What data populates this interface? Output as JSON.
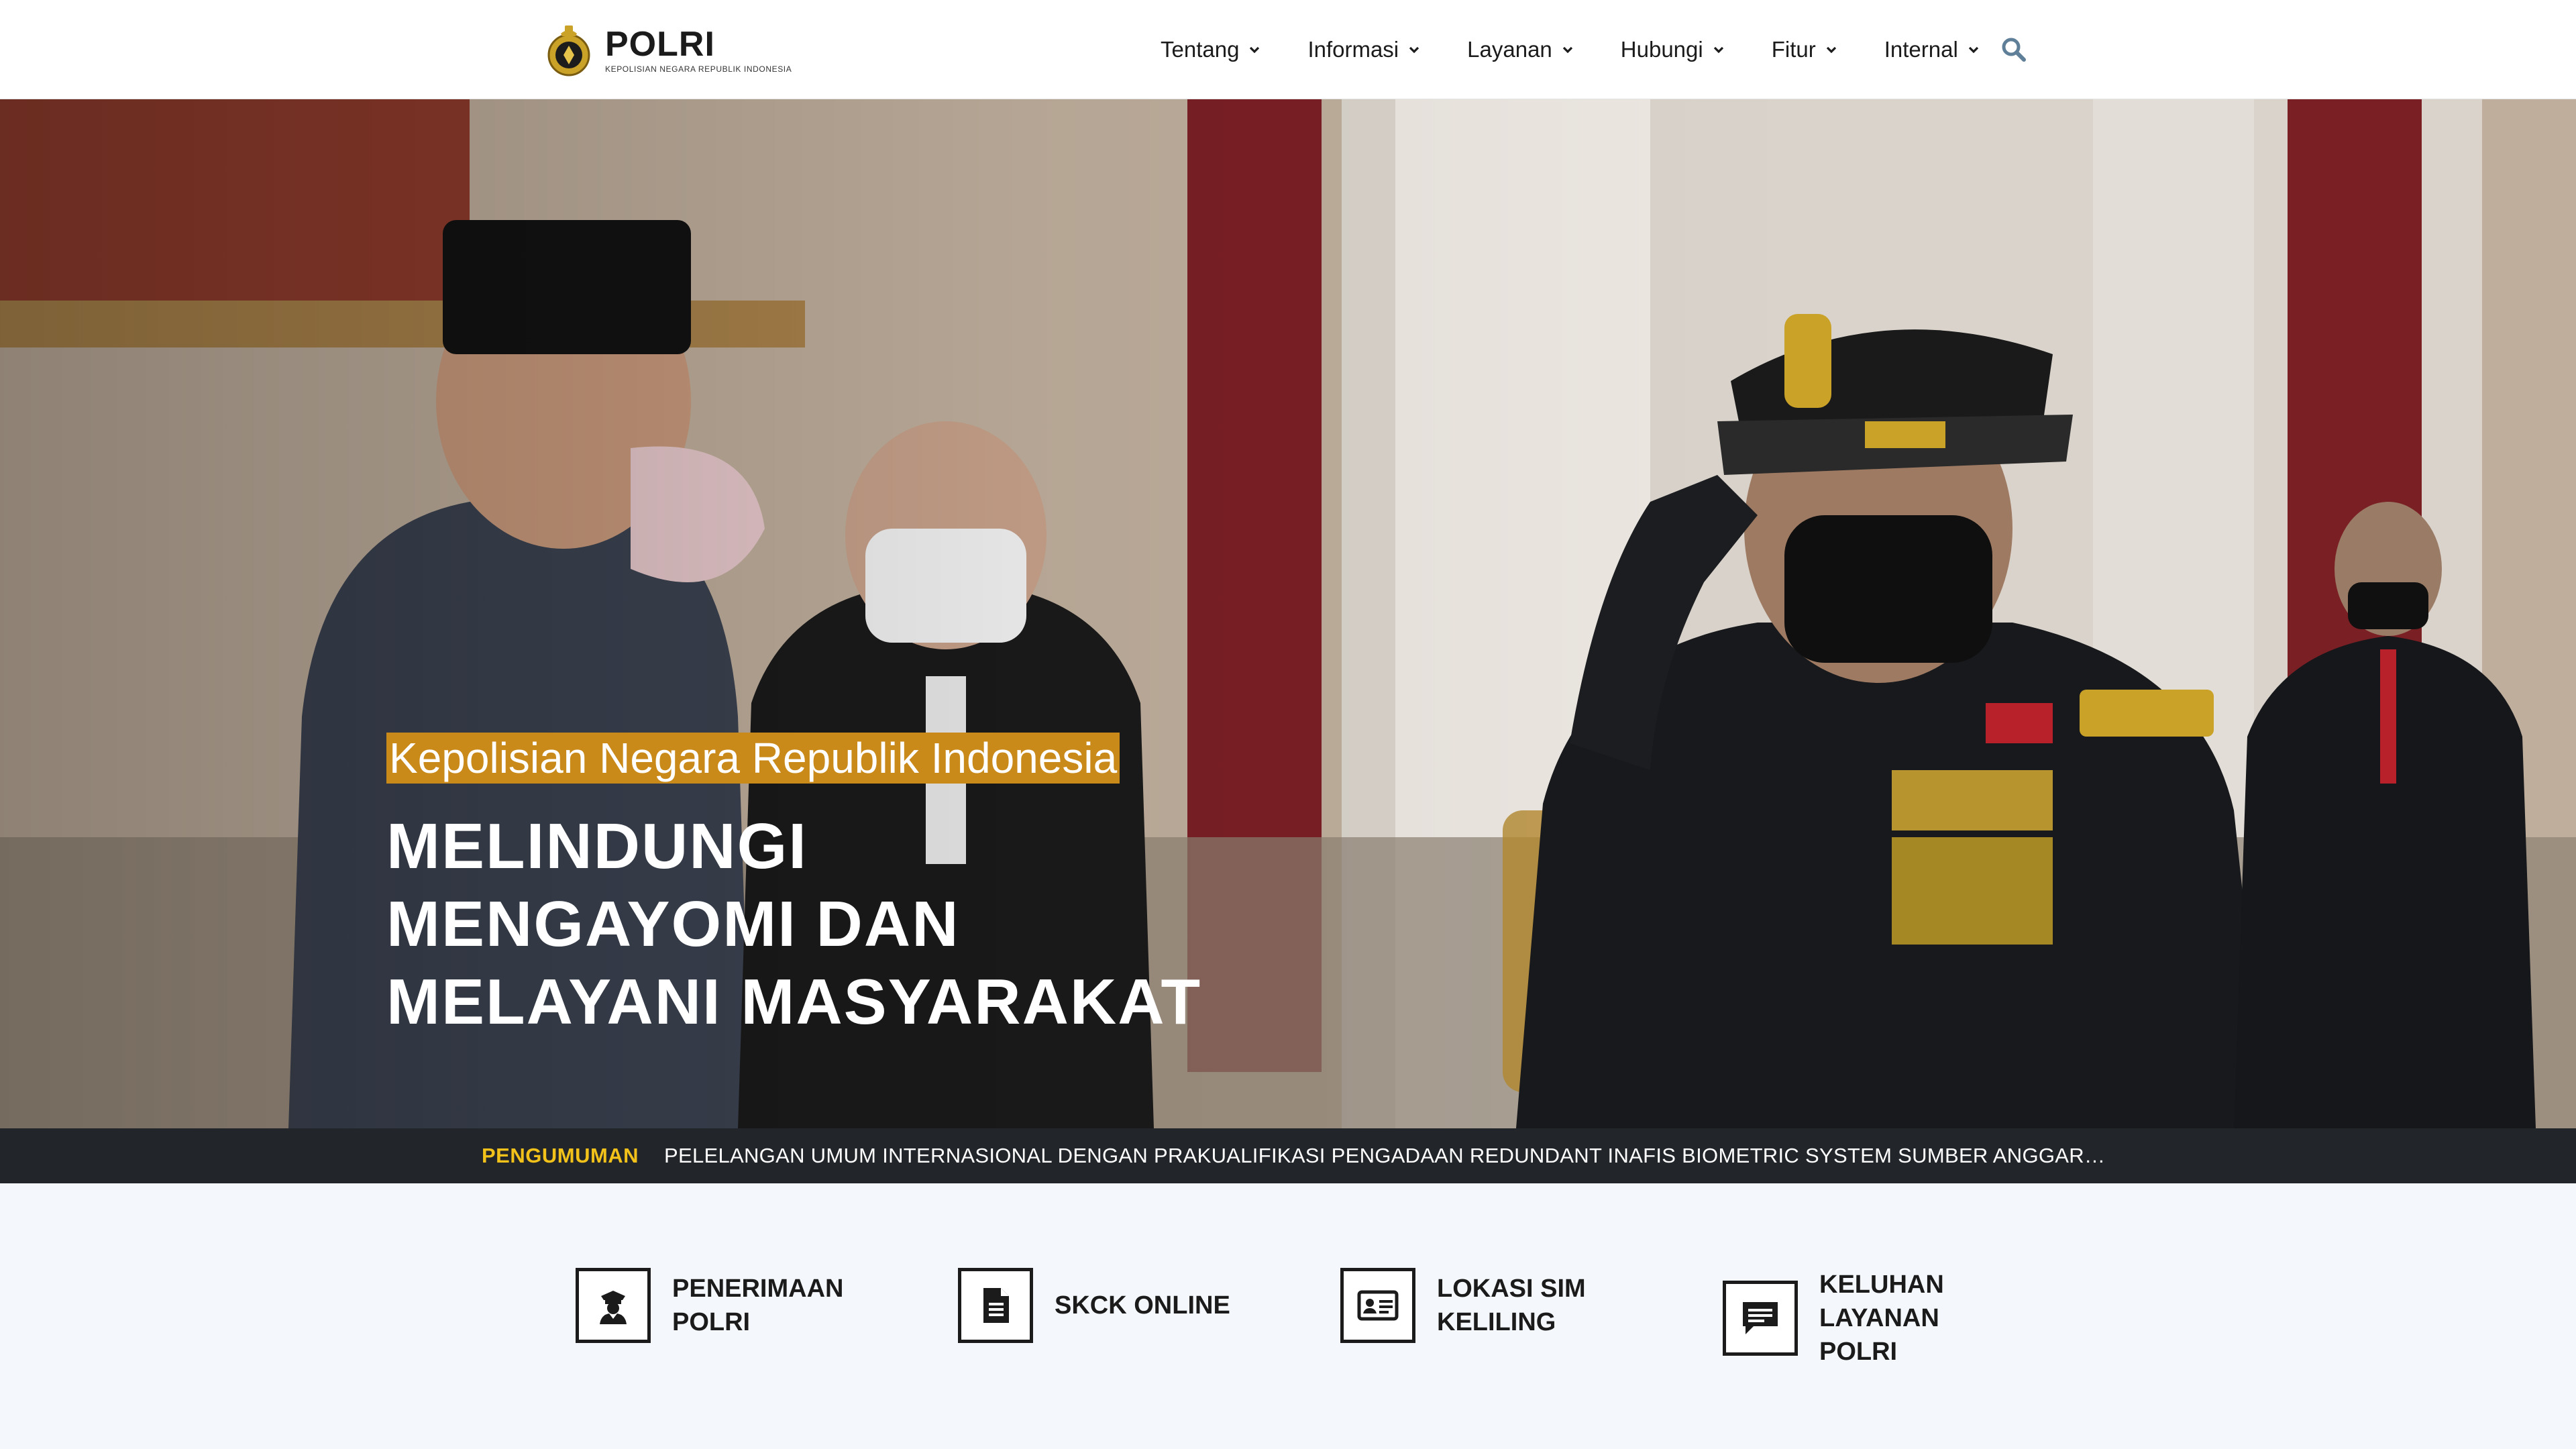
{
  "header": {
    "logo": {
      "title": "POLRI",
      "subtitle": "KEPOLISIAN NEGARA REPUBLIK INDONESIA"
    },
    "nav": [
      {
        "label": "Tentang",
        "icon": "chevron-down-icon"
      },
      {
        "label": "Informasi",
        "icon": "chevron-down-icon"
      },
      {
        "label": "Layanan",
        "icon": "chevron-down-icon"
      },
      {
        "label": "Hubungi",
        "icon": "chevron-down-icon"
      },
      {
        "label": "Fitur",
        "icon": "chevron-down-icon"
      },
      {
        "label": "Internal",
        "icon": "chevron-down-icon"
      }
    ],
    "search_icon": "search-icon"
  },
  "hero": {
    "kicker": "Kepolisian Negara Republik Indonesia",
    "title_lines": [
      "MELINDUNGI",
      "MENGAYOMI DAN",
      "MELAYANI MASYARAKAT"
    ]
  },
  "announcement": {
    "label": "PENGUMUMAN",
    "text": "PELELANGAN UMUM INTERNASIONAL DENGAN PRAKUALIFIKASI PENGADAAN REDUNDANT INAFIS BIOMETRIC SYSTEM SUMBER ANGGARAN KREDITOR SW…"
  },
  "quick_links": [
    {
      "line1": "PENERIMAAN",
      "line2": "POLRI",
      "icon": "police-officer-icon"
    },
    {
      "line1": "SKCK ONLINE",
      "line2": "",
      "icon": "document-icon"
    },
    {
      "line1": "LOKASI SIM",
      "line2": "KELILING",
      "icon": "id-card-icon"
    },
    {
      "line1": "KELUHAN",
      "line2": "LAYANAN POLRI",
      "icon": "chat-bubble-icon"
    }
  ],
  "colors": {
    "accent_gold": "#c98a1a",
    "ticker_label": "#f2c21a",
    "ticker_bg": "#22262b",
    "quick_bg": "#f4f8fc"
  }
}
